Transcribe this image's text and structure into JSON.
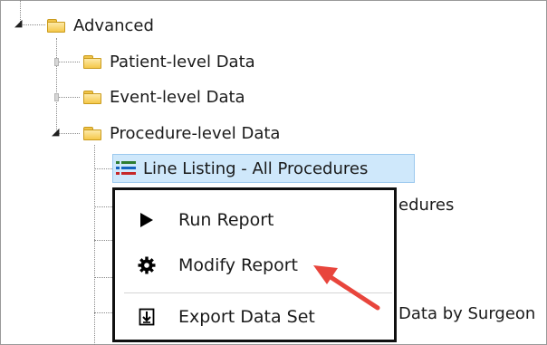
{
  "tree": {
    "root": {
      "label": "Advanced",
      "expanded": true
    },
    "children": [
      {
        "label": "Patient-level Data",
        "icon": "folder-icon"
      },
      {
        "label": "Event-level Data",
        "icon": "folder-icon"
      },
      {
        "label": "Procedure-level Data",
        "icon": "folder-icon",
        "expanded": true
      }
    ],
    "selected_item": {
      "label": "Line Listing - All Procedures",
      "icon": "list-icon"
    },
    "partial_labels": {
      "behind_menu_1": "edures",
      "behind_menu_2": "Data by Surgeon"
    }
  },
  "context_menu": {
    "items": [
      {
        "label": "Run Report",
        "icon": "play-icon"
      },
      {
        "label": "Modify Report",
        "icon": "gear-icon"
      },
      {
        "label": "Export Data Set",
        "icon": "export-icon"
      }
    ]
  },
  "colors": {
    "selection_bg": "#cfe8fb",
    "folder": "#f5c84a",
    "arrow": "#e8453c",
    "menu_border": "#101010"
  }
}
